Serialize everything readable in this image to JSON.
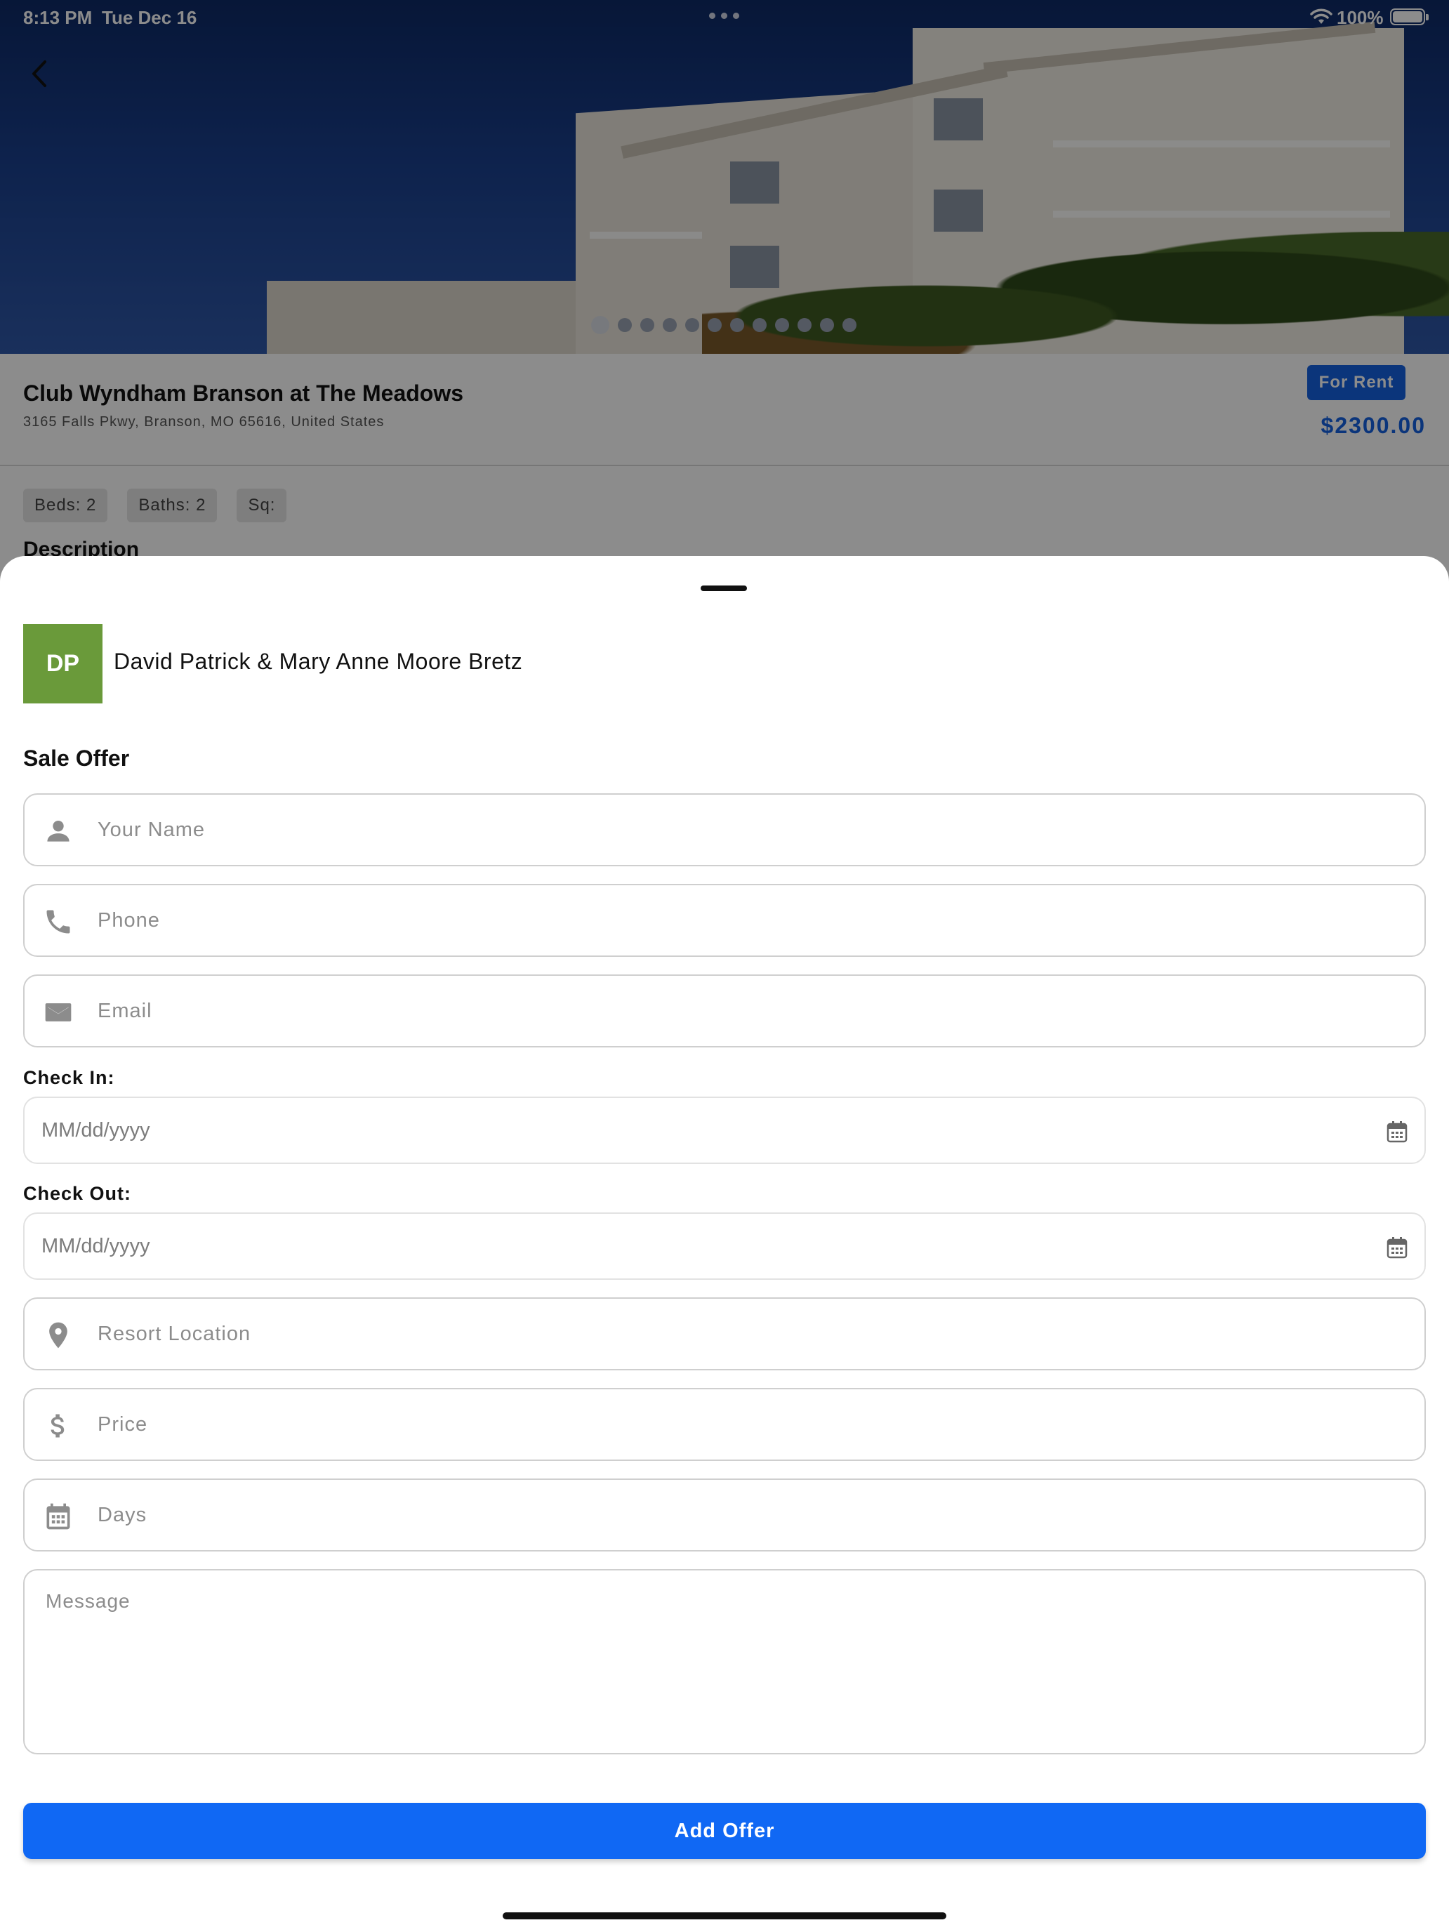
{
  "status_bar": {
    "time": "8:13 PM",
    "date": "Tue Dec 16",
    "battery": "100%"
  },
  "property": {
    "title": "Club Wyndham Branson at The Meadows",
    "address": "3165 Falls Pkwy, Branson, MO 65616, United States",
    "badge": "For Rent",
    "price": "$2300.00",
    "chips": [
      "Beds: 2",
      "Baths: 2",
      "Sq:"
    ],
    "description_label": "Description",
    "carousel": {
      "total": 12,
      "active": 1
    }
  },
  "sheet": {
    "owner": {
      "initials": "DP",
      "name": "David Patrick & Mary Anne Moore Bretz",
      "avatar_color": "#6a9a3a"
    },
    "section_title": "Sale Offer",
    "fields": {
      "name": {
        "placeholder": "Your Name",
        "icon": "person-icon"
      },
      "phone": {
        "placeholder": "Phone",
        "icon": "phone-icon"
      },
      "email": {
        "placeholder": "Email",
        "icon": "email-icon"
      },
      "check_in": {
        "label": "Check In:",
        "placeholder": "MM/dd/yyyy",
        "icon": "calendar-icon"
      },
      "check_out": {
        "label": "Check Out:",
        "placeholder": "MM/dd/yyyy",
        "icon": "calendar-icon"
      },
      "location": {
        "placeholder": "Resort Location",
        "icon": "location-pin-icon"
      },
      "price": {
        "placeholder": "Price",
        "icon": "dollar-icon"
      },
      "days": {
        "placeholder": "Days",
        "icon": "calendar-icon"
      },
      "message": {
        "placeholder": "Message"
      }
    },
    "submit_label": "Add Offer"
  },
  "colors": {
    "accent": "#1068f4",
    "price": "#1461e0",
    "avatar": "#6a9a3a"
  }
}
